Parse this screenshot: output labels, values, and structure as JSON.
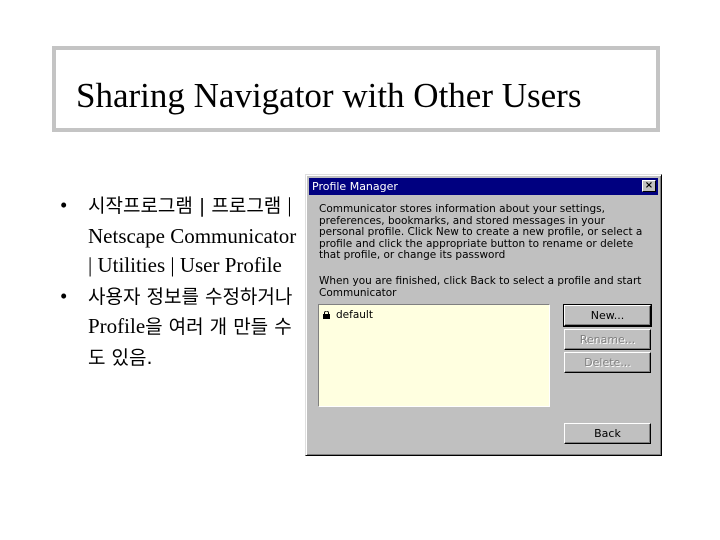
{
  "slide": {
    "title": "Sharing Navigator with Other Users",
    "bullets": [
      {
        "marker": "•",
        "parts": [
          {
            "text": "시작프로그램 | 프로그램 ",
            "lang": "kr"
          },
          {
            "text": "| Netscape Communicator | Utilities | User Profile",
            "lang": "en"
          }
        ]
      },
      {
        "marker": "•",
        "parts": [
          {
            "text": "사용자 정보를 수정하거나 ",
            "lang": "kr"
          },
          {
            "text": "Profile",
            "lang": "en"
          },
          {
            "text": "을 여러 개 만들 수도 있음.",
            "lang": "kr"
          }
        ]
      }
    ]
  },
  "dialog": {
    "title": "Profile Manager",
    "close_glyph": "×",
    "paragraph1": "Communicator stores information about your settings, preferences, bookmarks, and stored messages in your personal profile. Click New to create a new profile, or select a profile and click the appropriate button to rename or delete that profile, or change its password",
    "paragraph2": "When you are finished, click Back to select a profile and start Communicator",
    "profiles": [
      "default"
    ],
    "buttons": {
      "new": "New...",
      "rename": "Rename...",
      "delete": "Delete...",
      "back": "Back"
    }
  },
  "icons": {
    "profile_item": "lock-icon",
    "close": "close-icon",
    "bullet": "bullet-dot"
  }
}
